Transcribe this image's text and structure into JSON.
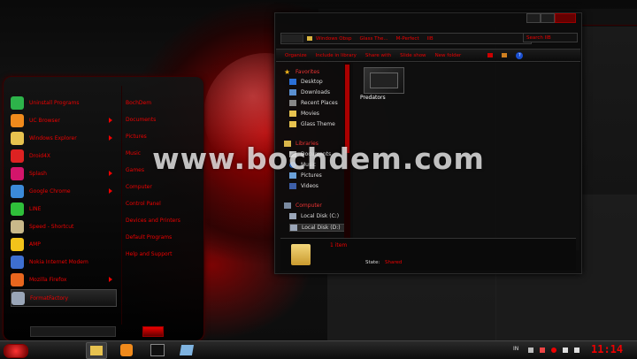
{
  "start_menu": {
    "programs": [
      {
        "label": "Uninstall Programs",
        "icon": "uninstall-icon",
        "color": "#2db34a",
        "arrow": false
      },
      {
        "label": "UC Browser",
        "icon": "uc-browser-icon",
        "color": "#f08a1c",
        "arrow": true
      },
      {
        "label": "Windows Explorer",
        "icon": "folder-icon",
        "color": "#e7c24f",
        "arrow": true
      },
      {
        "label": "Droid4X",
        "icon": "droid4x-icon",
        "color": "#d22",
        "arrow": false
      },
      {
        "label": "Splash",
        "icon": "splash-icon",
        "color": "#d3156b",
        "arrow": true
      },
      {
        "label": "Google Chrome",
        "icon": "chrome-icon",
        "color": "#3b8ad9",
        "arrow": true
      },
      {
        "label": "LINE",
        "icon": "line-icon",
        "color": "#2fbf3a",
        "arrow": false
      },
      {
        "label": "Speed - Shortcut",
        "icon": "shortcut-icon",
        "color": "#c9b98a",
        "arrow": false
      },
      {
        "label": "AMP",
        "icon": "amp-icon",
        "color": "#f3c31a",
        "arrow": false
      },
      {
        "label": "Nokia Internet Modem",
        "icon": "modem-icon",
        "color": "#3e6fd0",
        "arrow": false
      },
      {
        "label": "Mozilla Firefox",
        "icon": "firefox-icon",
        "color": "#e8661e",
        "arrow": true
      },
      {
        "label": "FormatFactory",
        "icon": "format-factory-icon",
        "color": "#9aa6b8",
        "arrow": false
      }
    ],
    "places": [
      "BochDem",
      "Documents",
      "Pictures",
      "Music",
      "Games",
      "Computer",
      "Control Panel",
      "Devices and Printers",
      "Default Programs",
      "Help and Support"
    ]
  },
  "explorer": {
    "breadcrumb": [
      "Windows Obsp",
      "Glass The...",
      "M-Perfect",
      "IIB"
    ],
    "search_placeholder": "Search IIB",
    "toolbar": [
      "Organize",
      "Include in library",
      "Share with",
      "Slide show",
      "New folder"
    ],
    "nav": {
      "favorites_header": "Favorites",
      "favorites": [
        "Desktop",
        "Downloads",
        "Recent Places",
        "Movies",
        "Glass Theme"
      ],
      "libraries_header": "Libraries",
      "libraries": [
        "Documents",
        "Music",
        "Pictures",
        "Videos"
      ],
      "computer_header": "Computer",
      "drives": [
        "Local Disk (C:)",
        "Local Disk (D:)"
      ]
    },
    "file": {
      "name": "Predators"
    },
    "details": {
      "count": "1 item",
      "state_label": "State:",
      "state_value": "Shared"
    }
  },
  "watermark": "www.bochdem.com",
  "taskbar": {
    "apps": [
      "folder-icon",
      "uc-browser-icon",
      "terminal-icon",
      "paper-icon"
    ],
    "language": "IN",
    "clock": "11:14"
  },
  "colors": {
    "accent": "#e00000",
    "background": "#050505"
  }
}
